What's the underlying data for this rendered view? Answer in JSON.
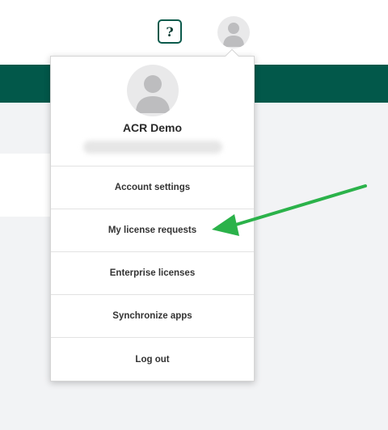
{
  "header": {
    "help_label": "?",
    "avatar_icon": "user-avatar-icon"
  },
  "user_menu": {
    "user_name": "ACR Demo",
    "avatar_icon": "user-avatar-icon",
    "items": [
      {
        "label": "Account settings"
      },
      {
        "label": "My license requests"
      },
      {
        "label": "Enterprise licenses"
      },
      {
        "label": "Synchronize apps"
      },
      {
        "label": "Log out"
      }
    ]
  },
  "annotation": {
    "arrow_color": "#2bb24a",
    "points_to": "My license requests"
  },
  "colors": {
    "brand_green": "#02584a",
    "background": "#f2f3f5"
  }
}
